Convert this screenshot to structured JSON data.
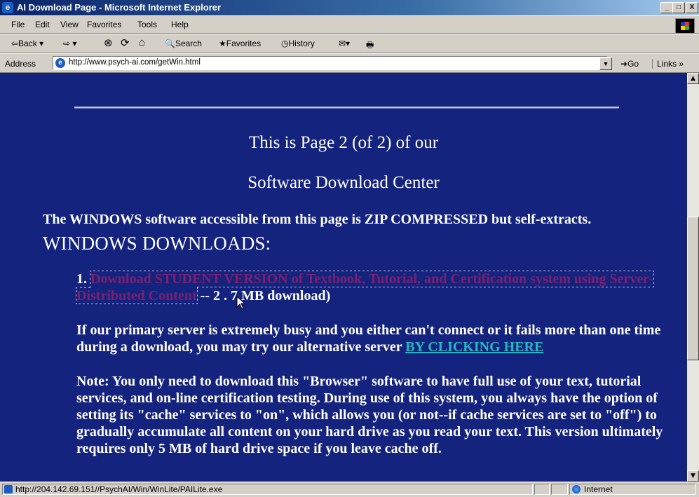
{
  "window": {
    "title": "AI Download Page - Microsoft Internet Explorer",
    "buttons": {
      "minimize": "_",
      "maximize": "□",
      "close": "X"
    }
  },
  "menu": [
    "File",
    "Edit",
    "View",
    "Favorites",
    "Tools",
    "Help"
  ],
  "toolbar": {
    "back": "⇦Back ▾",
    "forward": "⇨ ▾",
    "stop": "⊗",
    "refresh": "⟳",
    "home": "⌂",
    "search": "Search",
    "favorites": "Favorites",
    "history": "History",
    "mail": "✉▾",
    "print": "🖶"
  },
  "address": {
    "label": "Address",
    "url": "http://www.psych-ai.com/getWin.html",
    "go": "Go",
    "links": "Links »"
  },
  "page": {
    "heading1": "This is Page 2 (of 2) of our",
    "heading2": "Software Download Center",
    "zip_note": "The WINDOWS software accessible from this page is ZIP COMPRESSED but self-extracts.",
    "section_title": "WINDOWS DOWNLOADS:",
    "item1_number": "1.",
    "item1_link": "Download STUDENT VERSION of Textbook, Tutorial, and Certification system using Server-Distributed Content",
    "item1_suffix": " -- 2 . 7 MB download)",
    "alt_server_text": "If our primary server is extremely busy and you either can't connect or it fails more than one time during a download, you may try our alternative server ",
    "alt_server_link": "BY CLICKING HERE",
    "note_text": "Note: You only need to download this \"Browser\" software to have full use of your text, tutorial services, and on-line certification testing. During use of this system, you always have the option of setting its \"cache\" services to \"on\", which allows you (or not--if cache services are set to \"off\") to gradually accumulate all content on your hard drive as you read your text. This version ultimately requires only 5 MB of hard drive space if you leave cache off."
  },
  "status": {
    "text": "http://204.142.69.151//PsychAI/Win/WinLite/PAILite.exe",
    "zone": "Internet"
  },
  "colors": {
    "page_bg": "#14237d",
    "visited_link": "#7d2070",
    "link": "#28b7c2",
    "titlebar_start": "#0a246a"
  }
}
